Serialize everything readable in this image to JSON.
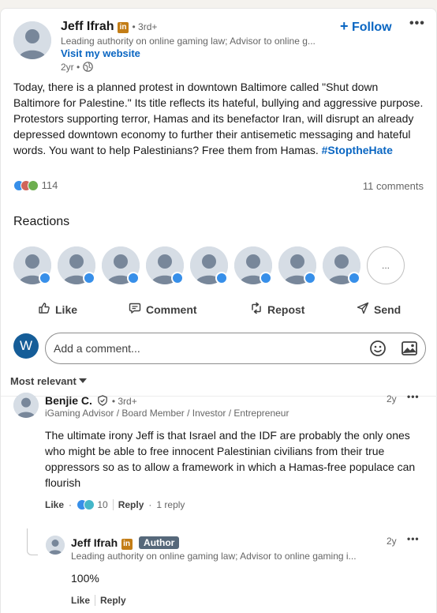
{
  "post": {
    "author": {
      "name": "Jeff Ifrah",
      "linkedin_badge": "in",
      "degree": "3rd+",
      "headline": "Leading authority on online gaming law; Advisor to online g...",
      "website_link": "Visit my website",
      "time": "2yr",
      "visibility_icon": "globe-icon"
    },
    "follow_label": "Follow",
    "more_icon": "more-horizontal-icon",
    "text": "Today, there is a planned protest in downtown Baltimore called \"Shut down Baltimore for Palestine.\" Its title reflects its hateful, bullying and aggressive purpose. Protestors supporting terror, Hamas and its benefactor Iran, will disrupt an already depressed downtown economy to further their antisemetic messaging and hateful words. You want to help Palestinians? Free them from Hamas.",
    "hashtag": "#StoptheHate",
    "reaction_count": "114",
    "comments_count": "11 comments"
  },
  "reactions_section": {
    "title": "Reactions",
    "more_label": "..."
  },
  "actions": {
    "like": "Like",
    "comment": "Comment",
    "repost": "Repost",
    "send": "Send"
  },
  "composer": {
    "avatar_letter": "W",
    "placeholder": "Add a comment...",
    "emoji_icon": "emoji-icon",
    "image_icon": "image-icon"
  },
  "sort": {
    "label": "Most relevant"
  },
  "comments": [
    {
      "name": "Benjie C.",
      "verified_icon": "verified-shield-icon",
      "degree": "3rd+",
      "headline": "iGaming Advisor / Board Member / Investor / Entrepreneur",
      "time": "2y",
      "text": "The ultimate irony Jeff is that Israel and the IDF are probably the only ones who might be able to free innocent Palestinian civilians from their true oppressors so as to allow a framework in which a Hamas-free populace can flourish",
      "like_label": "Like",
      "reaction_count": "10",
      "reply_label": "Reply",
      "replies_label": "1 reply"
    }
  ],
  "reply": {
    "name": "Jeff Ifrah",
    "linkedin_badge": "in",
    "author_badge": "Author",
    "headline": "Leading authority on online gaming law; Advisor to online gaming i...",
    "time": "2y",
    "text": "100%",
    "like_label": "Like",
    "reply_label": "Reply"
  },
  "colors": {
    "brand_blue": "#0a66c2",
    "like_blue": "#378fe9",
    "author_badge": "#56687a"
  }
}
